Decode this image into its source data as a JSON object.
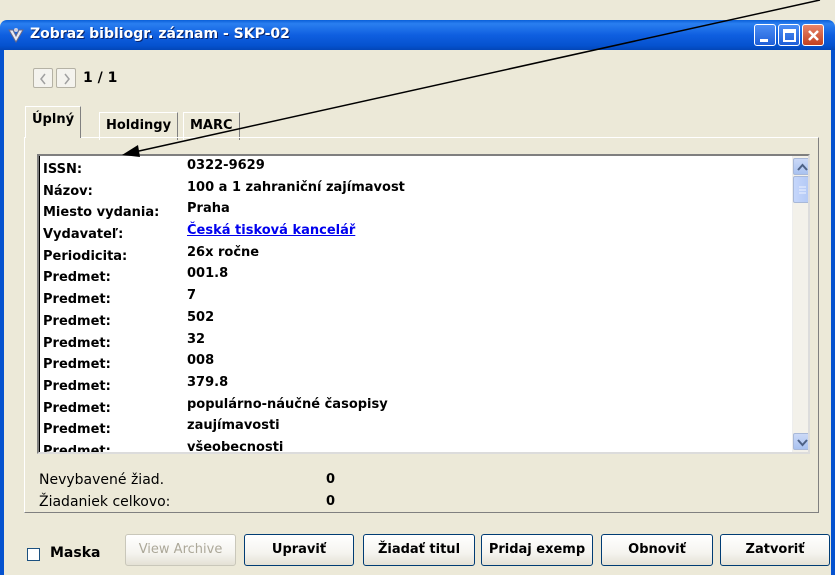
{
  "window": {
    "title": "Zobraz bibliogr. záznam - SKP-02",
    "icons": [
      "app-icon",
      "minimize-icon",
      "maximize-icon",
      "close-icon"
    ]
  },
  "navigation": {
    "counter": "1 / 1"
  },
  "tabs": [
    {
      "label": "Úplný",
      "active": true
    },
    {
      "label": "Holdingy",
      "active": false
    },
    {
      "label": "MARC",
      "active": false
    }
  ],
  "record": {
    "fields": [
      {
        "label": "ISSN:",
        "value": "0322-9629"
      },
      {
        "label": "Názov:",
        "value": "100 a 1 zahraniční zajímavost"
      },
      {
        "label": "Miesto vydania:",
        "value": "Praha"
      },
      {
        "label": "Vydavateľ:",
        "value": "Česká tisková kancelář",
        "link": true
      },
      {
        "label": "Periodicita:",
        "value": "26x ročne"
      },
      {
        "label": "Predmet:",
        "value": "001.8"
      },
      {
        "label": "Predmet:",
        "value": "7"
      },
      {
        "label": "Predmet:",
        "value": "502"
      },
      {
        "label": "Predmet:",
        "value": "32"
      },
      {
        "label": "Predmet:",
        "value": "008"
      },
      {
        "label": "Predmet:",
        "value": "379.8"
      },
      {
        "label": "Predmet:",
        "value": "populárno-náučné časopisy"
      },
      {
        "label": "Predmet:",
        "value": "zaujímavosti"
      },
      {
        "label": "Predmet:",
        "value": "všeobecnosti"
      }
    ]
  },
  "stats": {
    "pending_label": "Nevybavené žiad.",
    "pending_value": "0",
    "total_label": "Žiadaniek celkovo:",
    "total_value": "0"
  },
  "footer": {
    "mask_label": "Maska",
    "mask_checked": false,
    "buttons": [
      {
        "label": "View Archive",
        "enabled": false
      },
      {
        "label": "Upraviť",
        "enabled": true
      },
      {
        "label": "Žiadať titul",
        "enabled": true
      },
      {
        "label": "Pridaj exemp",
        "enabled": true
      },
      {
        "label": "Obnoviť",
        "enabled": true
      },
      {
        "label": "Zatvoriť",
        "enabled": true
      }
    ]
  },
  "colors": {
    "titlebar": "#0552cf",
    "link": "#0000ee",
    "window_bg": "#ece9d8"
  }
}
